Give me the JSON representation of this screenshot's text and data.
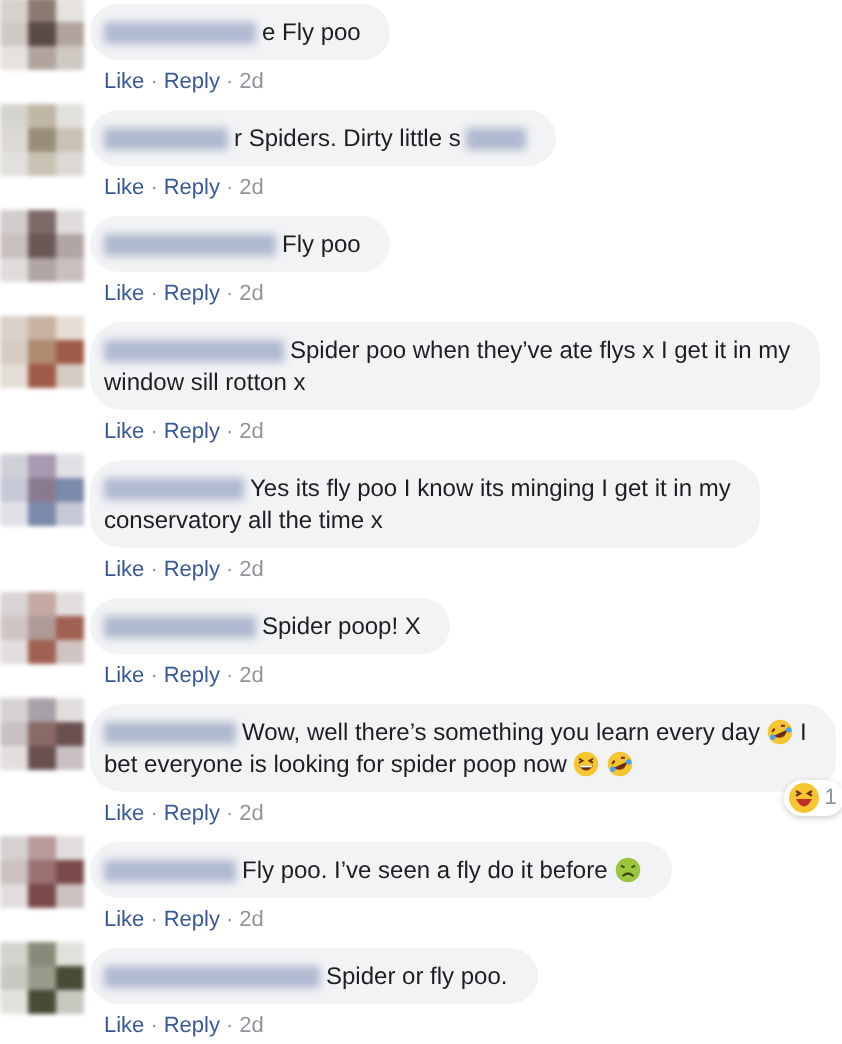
{
  "comments": [
    {
      "lines": [
        [
          {
            "kind": "blur"
          },
          {
            "kind": "text",
            "text": "e Fly poo"
          }
        ]
      ],
      "meta": [
        {
          "kind": "link",
          "text": "Like"
        },
        {
          "kind": "dot",
          "text": "·"
        },
        {
          "kind": "link",
          "text": "Reply"
        },
        {
          "kind": "dot",
          "text": "·"
        },
        {
          "kind": "time",
          "text": "2d"
        }
      ]
    },
    {
      "lines": [
        [
          {
            "kind": "blur"
          },
          {
            "kind": "text",
            "text": "r Spiders. Dirty little s"
          },
          {
            "kind": "blur"
          }
        ]
      ],
      "meta": [
        {
          "kind": "link",
          "text": "Like"
        },
        {
          "kind": "dot",
          "text": "·"
        },
        {
          "kind": "link",
          "text": "Reply"
        },
        {
          "kind": "dot",
          "text": "·"
        },
        {
          "kind": "time",
          "text": "2d"
        }
      ]
    },
    {
      "lines": [
        [
          {
            "kind": "blur"
          },
          {
            "kind": "text",
            "text": "Fly poo"
          }
        ]
      ],
      "meta": [
        {
          "kind": "link",
          "text": "Like"
        },
        {
          "kind": "dot",
          "text": "·"
        },
        {
          "kind": "link",
          "text": "Reply"
        },
        {
          "kind": "dot",
          "text": "·"
        },
        {
          "kind": "time",
          "text": "2d"
        }
      ]
    },
    {
      "lines": [
        [
          {
            "kind": "blur"
          },
          {
            "kind": "text",
            "text": "Spider poo when they’ve ate flys x I get it in my"
          }
        ],
        [
          {
            "kind": "text",
            "text": "window sill rotton x"
          }
        ]
      ],
      "meta": [
        {
          "kind": "link",
          "text": "Like"
        },
        {
          "kind": "dot",
          "text": "·"
        },
        {
          "kind": "link",
          "text": "Reply"
        },
        {
          "kind": "dot",
          "text": "·"
        },
        {
          "kind": "time",
          "text": "2d"
        }
      ]
    },
    {
      "lines": [
        [
          {
            "kind": "blur"
          },
          {
            "kind": "text",
            "text": "Yes its fly poo I know its minging I get it in my"
          }
        ],
        [
          {
            "kind": "text",
            "text": "conservatory all the time x"
          }
        ]
      ],
      "meta": [
        {
          "kind": "link",
          "text": "Like"
        },
        {
          "kind": "dot",
          "text": "·"
        },
        {
          "kind": "link",
          "text": "Reply"
        },
        {
          "kind": "dot",
          "text": "·"
        },
        {
          "kind": "time",
          "text": "2d"
        }
      ]
    },
    {
      "lines": [
        [
          {
            "kind": "blur"
          },
          {
            "kind": "text",
            "text": "Spider poop! X"
          }
        ]
      ],
      "meta": [
        {
          "kind": "link",
          "text": "Like"
        },
        {
          "kind": "dot",
          "text": "·"
        },
        {
          "kind": "link",
          "text": "Reply"
        },
        {
          "kind": "dot",
          "text": "·"
        },
        {
          "kind": "time",
          "text": "2d"
        }
      ]
    },
    {
      "lines": [
        [
          {
            "kind": "blur"
          },
          {
            "kind": "text",
            "text": "Wow, well there’s something you learn every day"
          },
          {
            "kind": "rofl"
          },
          {
            "kind": "text",
            "text": "I"
          }
        ],
        [
          {
            "kind": "text",
            "text": "bet everyone is looking for spider poop now"
          },
          {
            "kind": "grin"
          },
          {
            "kind": "rofl"
          }
        ]
      ],
      "reaction_count": "1",
      "meta": [
        {
          "kind": "link",
          "text": "Like"
        },
        {
          "kind": "dot",
          "text": "·"
        },
        {
          "kind": "link",
          "text": "Reply"
        },
        {
          "kind": "dot",
          "text": "·"
        },
        {
          "kind": "time",
          "text": "2d"
        }
      ]
    },
    {
      "lines": [
        [
          {
            "kind": "blur"
          },
          {
            "kind": "text",
            "text": "Fly poo. I’ve seen a fly do it before"
          },
          {
            "kind": "sick"
          }
        ]
      ],
      "meta": [
        {
          "kind": "link",
          "text": "Like"
        },
        {
          "kind": "dot",
          "text": "·"
        },
        {
          "kind": "link",
          "text": "Reply"
        },
        {
          "kind": "dot",
          "text": "·"
        },
        {
          "kind": "time",
          "text": "2d"
        }
      ]
    },
    {
      "lines": [
        [
          {
            "kind": "blur"
          },
          {
            "kind": "text",
            "text": "Spider or fly poo."
          }
        ]
      ],
      "meta": [
        {
          "kind": "link",
          "text": "Like"
        },
        {
          "kind": "dot",
          "text": "·"
        },
        {
          "kind": "link",
          "text": "Reply"
        },
        {
          "kind": "dot",
          "text": "·"
        },
        {
          "kind": "time",
          "text": "2d"
        }
      ]
    }
  ]
}
